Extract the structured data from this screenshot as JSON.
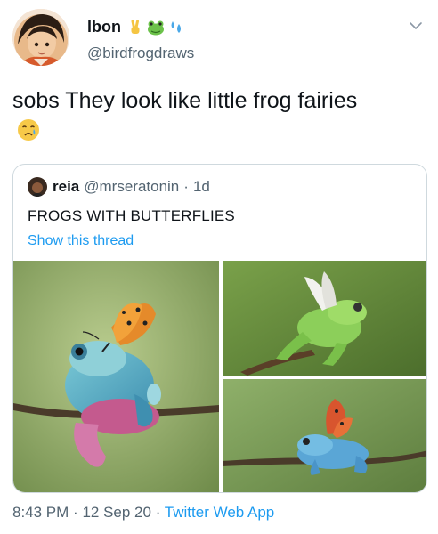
{
  "author": {
    "display_name": "lbon",
    "handle": "@birdfrogdraws",
    "name_emojis": [
      "victory-hand-emoji",
      "frog-emoji",
      "sweat-droplets-emoji"
    ]
  },
  "tweet": {
    "text": "sobs They look like little frog fairies",
    "trailing_emoji": "crying-face-emoji"
  },
  "quoted_tweet": {
    "display_name": "reia",
    "handle": "@mrseratonin",
    "separator": "·",
    "time_ago": "1d",
    "text": "FROGS WITH BUTTERFLIES",
    "show_thread": "Show this thread",
    "photos": [
      "frog-with-orange-butterfly",
      "green-frog-with-white-butterfly",
      "blue-frog-with-red-butterfly"
    ]
  },
  "meta": {
    "time": "8:43 PM",
    "sep1": "·",
    "date": "12 Sep 20",
    "sep2": "·",
    "source": "Twitter Web App"
  },
  "colors": {
    "link": "#1d9bf0",
    "secondary_text": "#536471",
    "border": "#cfd9de"
  }
}
